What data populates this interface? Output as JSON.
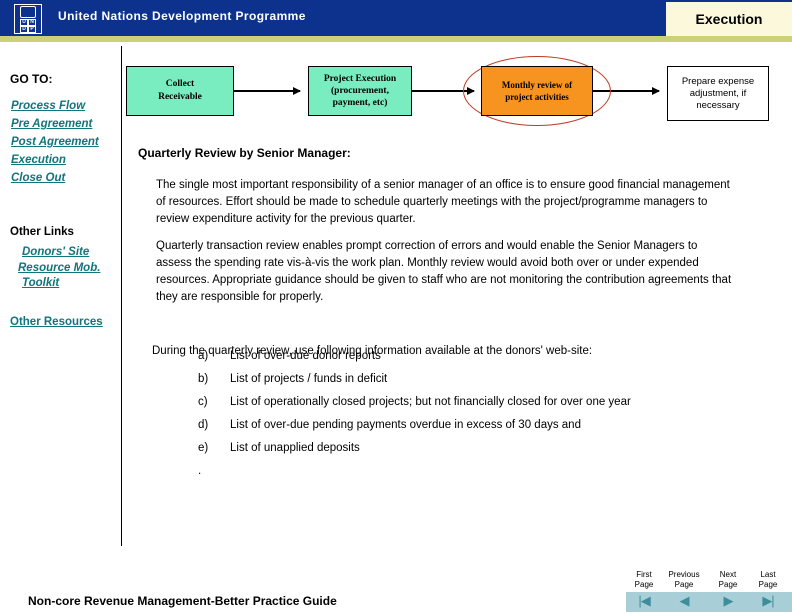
{
  "header": {
    "organization": "United Nations Development Programme",
    "section_tab": "Execution",
    "logo": {
      "letters": [
        "U",
        "N",
        "D",
        "P"
      ]
    },
    "colors": {
      "header_blue": "#0d328e",
      "accent_band": "#ccd077",
      "tab_cream": "#fbf8dc"
    }
  },
  "sidebar": {
    "goto_heading": "GO TO:",
    "goto_links": [
      {
        "label": "Process Flow"
      },
      {
        "label": "Pre Agreement"
      },
      {
        "label": "Post Agreement"
      },
      {
        "label": "Execution"
      },
      {
        "label": "Close Out"
      }
    ],
    "other_links_heading": "Other Links",
    "other_links": [
      {
        "label": "Donors' Site"
      },
      {
        "label": "Resource Mob."
      },
      {
        "label": "Toolkit"
      }
    ],
    "other_resources": "Other Resources",
    "link_color": "#11757b"
  },
  "flowchart": {
    "boxes": [
      {
        "label": "Collect\nReceivable",
        "line1": "Collect",
        "line2": "Receivable",
        "color": "#79edbf"
      },
      {
        "line1": "Project Execution",
        "line2": "(procurement,",
        "line3": "payment, etc)",
        "color": "#79edbf"
      },
      {
        "line1": "Monthly review  of",
        "line2": "project activities",
        "color": "#f79420",
        "highlighted": true
      },
      {
        "line1": "Prepare expense",
        "line2": "adjustment, if",
        "line3": "necessary",
        "color": "#ffffff"
      }
    ],
    "highlight_ellipse_color": "#c03a22"
  },
  "main": {
    "heading": "Quarterly Review by Senior Manager:",
    "paragraph_1": "The single most important responsibility of a senior manager of an office is to ensure good financial management of resources.  Effort should be made to schedule quarterly  meetings with the project/programme managers to review expenditure activity for the previous quarter.",
    "paragraph_2": "Quarterly  transaction review enables prompt correction of errors and would enable the Senior Managers to assess the spending rate vis-à-vis the work plan.  Monthly review would avoid both over or under expended resources.  Appropriate guidance should be given to staff who are not monitoring the contribution agreements that they are responsible for properly.",
    "paragraph_3": "During the  quarterly review, use following information available at the donors' web-site:",
    "list": [
      {
        "marker": "a)",
        "text": "List of over-due donor reports"
      },
      {
        "marker": "b)",
        "text": "List of projects / funds in deficit"
      },
      {
        "marker": "c)",
        "text": "List of operationally closed projects; but not financially closed for over one year"
      },
      {
        "marker": "d)",
        "text": "List of over-due pending payments overdue  in excess of 30 days and"
      },
      {
        "marker": "e)",
        "text": "List of unapplied deposits"
      }
    ],
    "list_trailing": "."
  },
  "footer": {
    "title": "Non-core Revenue Management-Better Practice Guide",
    "nav_buttons": [
      {
        "line1": "First",
        "line2": "Page",
        "glyph": "|◀",
        "name": "first-page"
      },
      {
        "line1": "Previous",
        "line2": "Page",
        "glyph": "◀",
        "name": "previous-page"
      },
      {
        "line1": "Next",
        "line2": "Page",
        "glyph": "▶",
        "name": "next-page"
      },
      {
        "line1": "Last",
        "line2": "Page",
        "glyph": "▶|",
        "name": "last-page"
      }
    ],
    "nav_bar_color": "#a8cfd8",
    "nav_glyph_color": "#3f8d9b"
  }
}
